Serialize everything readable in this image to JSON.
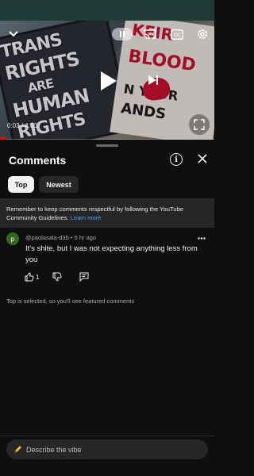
{
  "video": {
    "time": "0:03 / 4:00",
    "progress_fraction": 0.0125,
    "cc_label": "CC",
    "sign_left_lines": [
      "TRANS",
      "RIGHTS",
      "ARE",
      "HUMAN",
      "RIGHTS"
    ],
    "sign_right_lines": [
      "KEIR",
      "BLOOD",
      "N YOUR",
      "ANDS"
    ]
  },
  "comments_panel": {
    "title": "Comments",
    "chips": [
      {
        "label": "Top",
        "selected": true
      },
      {
        "label": "Newest",
        "selected": false
      }
    ],
    "notice_text": "Remember to keep comments respectful by following the YouTube Community Guidelines.",
    "notice_link": "Learn more"
  },
  "comment": {
    "avatar_letter": "p",
    "author": "@paolasala-d3b",
    "separator": "•",
    "age": "5 hr ago",
    "text": "It's shite, but I was not expecting anything less from you",
    "like_count": "1"
  },
  "footer_note": "Top is selected, so you'll see featured comments",
  "composer": {
    "placeholder": "Describe the vibe"
  },
  "colors": {
    "background": "#0f0f0f",
    "status_bar": "#1e3b36",
    "accent_red": "#ff0000",
    "link_blue": "#3ea6ff",
    "avatar_green": "#33691e"
  }
}
